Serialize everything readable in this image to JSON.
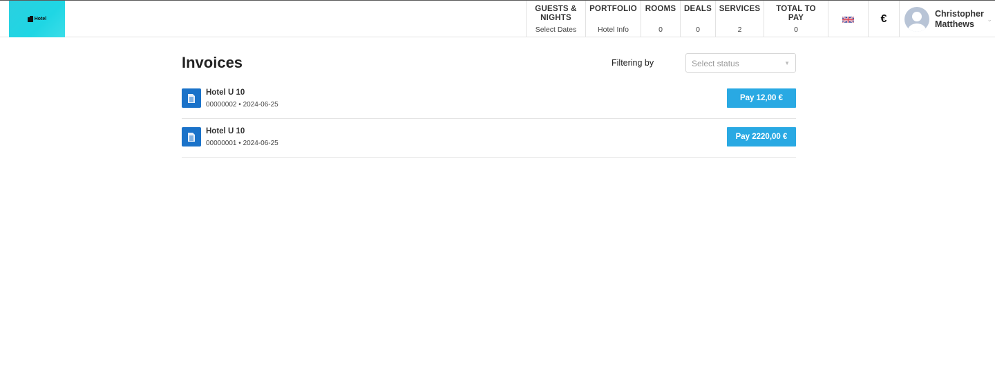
{
  "header": {
    "logo_text": "Hotel",
    "nav": [
      {
        "title": "GUESTS & NIGHTS",
        "sub": "Select Dates"
      },
      {
        "title": "PORTFOLIO",
        "sub": "Hotel Info"
      },
      {
        "title": "ROOMS",
        "sub": "0"
      },
      {
        "title": "DEALS",
        "sub": "0"
      },
      {
        "title": "SERVICES",
        "sub": "2"
      },
      {
        "title": "TOTAL TO PAY",
        "sub": "0"
      }
    ],
    "language_icon": "uk-flag-icon",
    "currency_symbol": "€",
    "user": {
      "first": "Christopher",
      "last": "Matthews"
    }
  },
  "main": {
    "title": "Invoices",
    "filter_label": "Filtering by",
    "status_select": {
      "placeholder": "Select status",
      "value": ""
    },
    "invoices": [
      {
        "name": "Hotel U 10",
        "number": "00000002",
        "date": "2024-06-25",
        "pay_label": "Pay 12,00 €"
      },
      {
        "name": "Hotel U 10",
        "number": "00000001",
        "date": "2024-06-25",
        "pay_label": "Pay 2220,00 €"
      }
    ]
  },
  "colors": {
    "accent": "#29a9e3",
    "logo_bg": "#1fd6e4",
    "doc_icon": "#1a72c9"
  }
}
